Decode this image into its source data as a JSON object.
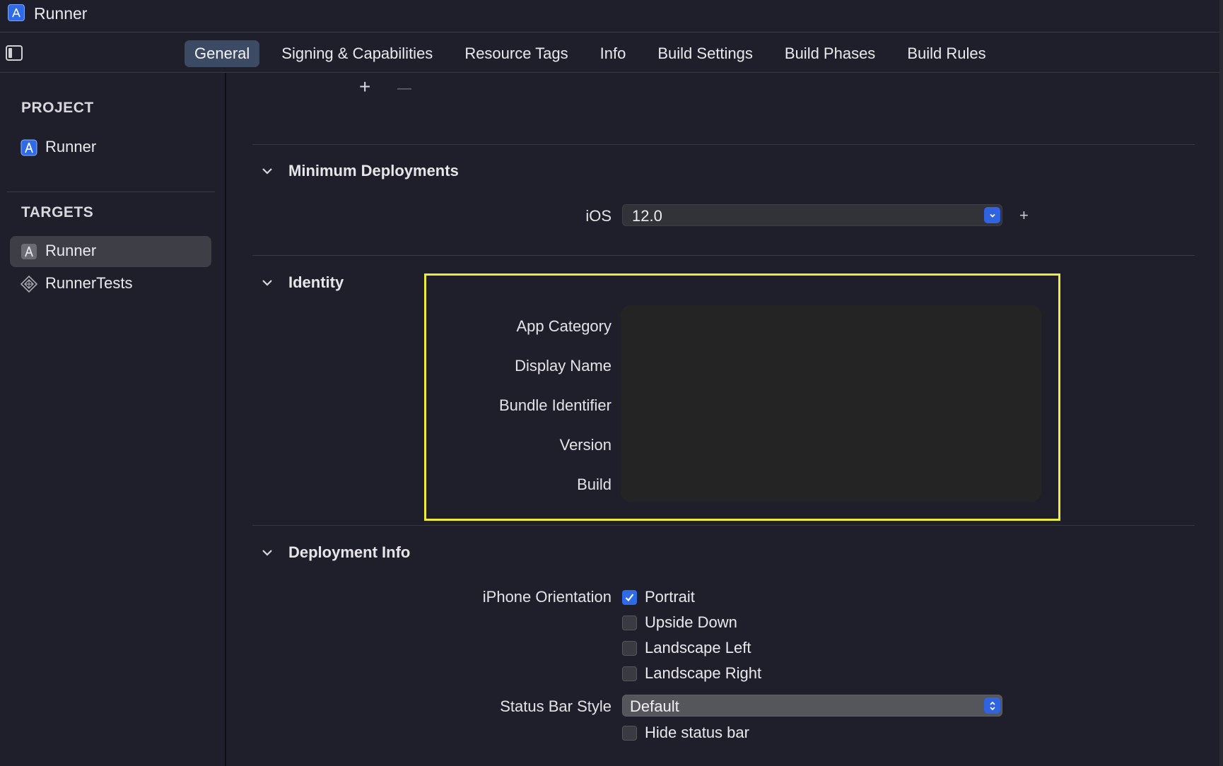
{
  "window": {
    "title": "Runner"
  },
  "tabs": [
    {
      "label": "General",
      "active": true
    },
    {
      "label": "Signing & Capabilities"
    },
    {
      "label": "Resource Tags"
    },
    {
      "label": "Info"
    },
    {
      "label": "Build Settings"
    },
    {
      "label": "Build Phases"
    },
    {
      "label": "Build Rules"
    }
  ],
  "sidebar": {
    "project_heading": "PROJECT",
    "project_item": "Runner",
    "targets_heading": "TARGETS",
    "targets": [
      {
        "label": "Runner",
        "selected": true
      },
      {
        "label": "RunnerTests"
      }
    ]
  },
  "toolbar_symbols": {
    "add": "+",
    "remove": "—"
  },
  "minimum_deployments": {
    "title": "Minimum Deployments",
    "ios_label": "iOS",
    "ios_value": "12.0",
    "add": "+"
  },
  "identity": {
    "title": "Identity",
    "labels": [
      "App Category",
      "Display Name",
      "Bundle Identifier",
      "Version",
      "Build"
    ]
  },
  "deployment_info": {
    "title": "Deployment Info",
    "iphone_orientation_label": "iPhone Orientation",
    "orientations": [
      {
        "label": "Portrait",
        "checked": true
      },
      {
        "label": "Upside Down",
        "checked": false
      },
      {
        "label": "Landscape Left",
        "checked": false
      },
      {
        "label": "Landscape Right",
        "checked": false
      }
    ],
    "status_bar_style_label": "Status Bar Style",
    "status_bar_style_value": "Default",
    "hide_status_bar_label": "Hide status bar",
    "hide_status_bar_checked": false
  },
  "colors": {
    "background": "#1f1f2b",
    "accent": "#2f6be6",
    "highlight_box": "#ecea3a",
    "selected_tab": "#3d4a63"
  }
}
